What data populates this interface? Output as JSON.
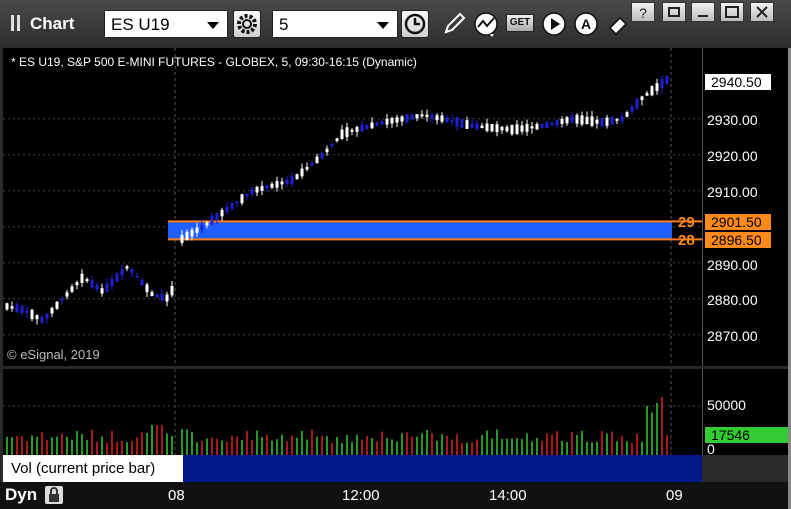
{
  "window": {
    "title": "Chart"
  },
  "toolbar": {
    "symbol": "ES U19",
    "interval": "5",
    "get_label": "GET"
  },
  "chart": {
    "info_line": "* ES U19, S&P 500 E-MINI FUTURES - GLOBEX, 5, 09:30-16:15 (Dynamic)",
    "copyright": "© eSignal, 2019",
    "price_ticks": [
      "2940.50",
      "2930.00",
      "2920.00",
      "2910.00",
      "2901.50",
      "2896.50",
      "2890.00",
      "2880.00",
      "2870.00"
    ],
    "last_price": "2940.50",
    "zone_high": "2901.50",
    "zone_low": "2896.50",
    "zone_high_short": "29",
    "zone_low_short": "28",
    "colors": {
      "up": "#ffffff",
      "down": "#1f1fd6",
      "zone": "#1f5fff",
      "zone_border": "#ff7a1a"
    }
  },
  "volume": {
    "title": "Vol (current price bar)",
    "close": "×",
    "ticks": [
      "50000",
      "0"
    ],
    "current": "17546"
  },
  "bottom": {
    "mode": "Dyn",
    "x_labels": [
      "08",
      "12:00",
      "14:00",
      "09"
    ]
  }
}
